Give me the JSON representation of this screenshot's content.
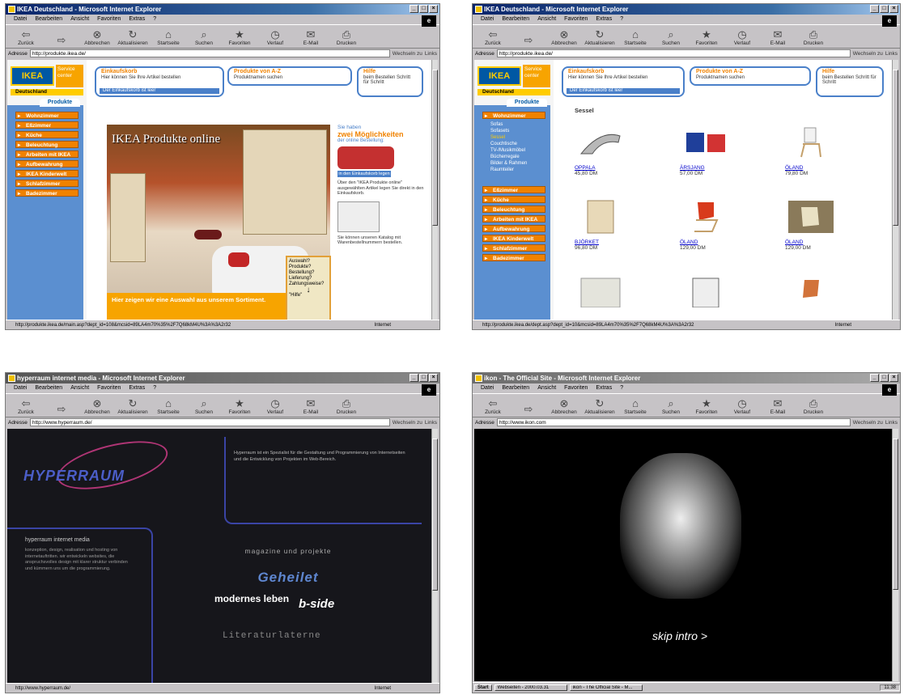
{
  "screenshots": [
    {
      "window_title": "IKEA Deutschland - Microsoft Internet Explorer",
      "address": "http://produkte.ikea.de/",
      "status_url": "http://produkte.ikea.de/main.asp?dept_id=108&mcsid=89LA4m70%35%2F7Q68kM4U%3A%3A2r32",
      "status_zone": "Internet"
    },
    {
      "window_title": "IKEA Deutschland - Microsoft Internet Explorer",
      "address": "http://produkte.ikea.de/",
      "status_url": "http://produkte.ikea.de/dept.asp?dept_id=10&mcsid=89LA4m70%35%2F7Q68kM4U%3A%3A2r32",
      "status_zone": "Internet"
    },
    {
      "window_title": "hyperraum internet media - Microsoft Internet Explorer",
      "address": "http://www.hyperraum.de/",
      "status_url": "http://www.hyperraum.de/",
      "status_zone": "Internet"
    },
    {
      "window_title": "ikon - The Official Site - Microsoft Internet Explorer",
      "address": "http://www.ikon.com",
      "status_url": "",
      "status_zone": ""
    }
  ],
  "browser": {
    "menu": [
      "Datei",
      "Bearbeiten",
      "Ansicht",
      "Favoriten",
      "Extras",
      "?"
    ],
    "toolbar": [
      {
        "label": "Zurück",
        "icon": "back-arrow-icon",
        "glyph": "⇦"
      },
      {
        "label": "",
        "icon": "forward-arrow-icon",
        "glyph": "⇨"
      },
      {
        "label": "Abbrechen",
        "icon": "stop-icon",
        "glyph": "⊗"
      },
      {
        "label": "Aktualisieren",
        "icon": "refresh-icon",
        "glyph": "↻"
      },
      {
        "label": "Startseite",
        "icon": "home-icon",
        "glyph": "⌂"
      },
      {
        "label": "Suchen",
        "icon": "search-icon",
        "glyph": "⌕"
      },
      {
        "label": "Favoriten",
        "icon": "favorites-icon",
        "glyph": "★"
      },
      {
        "label": "Verlauf",
        "icon": "history-icon",
        "glyph": "◷"
      },
      {
        "label": "E-Mail",
        "icon": "mail-icon",
        "glyph": "✉"
      },
      {
        "label": "Drucken",
        "icon": "print-icon",
        "glyph": "⎙"
      }
    ],
    "address_label": "Adresse",
    "go_label": "Wechseln zu",
    "links_label": "Links"
  },
  "ikea": {
    "logo": "IKEA",
    "corner_text": "Service center",
    "country": "Deutschland",
    "nav_tab": "Produkte",
    "nav_items": [
      "Wohnzimmer",
      "Eßzimmer",
      "Küche",
      "Beleuchtung",
      "Arbeiten mit IKEA",
      "Aufbewahrung",
      "IKEA Kinderwelt",
      "Schlafzimmer",
      "Badezimmer"
    ],
    "sub_items": [
      "Sofas",
      "Sofasets",
      "Sessel",
      "Couchtische",
      "TV-/Musikmöbel",
      "Bücherregale",
      "Bilder & Rahmen",
      "Raumteiler"
    ],
    "panel_cart": {
      "title": "Einkaufskorb",
      "text": "Hier können Sie Ihre Artikel bestellen",
      "bar": "Der Einkaufskorb ist leer"
    },
    "panel_az": {
      "title": "Produkte von A-Z",
      "text": "Produktnamen suchen"
    },
    "panel_help": {
      "title": "Hilfe",
      "text": "beim Bestellen Schritt für Schritt"
    },
    "hero_title": "IKEA Produkte online",
    "hero_caption": "Hier zeigen wir eine Auswahl aus unserem Sortiment.",
    "hero_side": "Auswahl? Produkte? Bestellung? Lieferung? Zahlungsweise?",
    "hero_side_help": "\"Hilfe\"",
    "promo_line1": "Sie haben",
    "promo_line2": "zwei Möglichkeiten",
    "promo_line3": "der online Bestellung:",
    "promo_cta": "in den Einkaufskorb legen",
    "promo_text1": "Über den \"IKEA Produkte online\" ausgewählten Artikel legen Sie direkt in den Einkaufskorb.",
    "promo_text2": "Sie können unseren Katalog mit Warenbestellnummern bestellen.",
    "category": "Sessel",
    "products": [
      {
        "name": "OPPALA",
        "price": "45,80 DM"
      },
      {
        "name": "ÄRSJANG",
        "price": "57,00 DM"
      },
      {
        "name": "ÖLAND",
        "price": "79,80 DM"
      },
      {
        "name": "BJÖRKET",
        "price": "96,80 DM"
      },
      {
        "name": "ÖLAND",
        "price": "129,00 DM"
      },
      {
        "name": "ÖLAND",
        "price": "129,00 DM"
      },
      {
        "name": "",
        "price": ""
      },
      {
        "name": "",
        "price": ""
      },
      {
        "name": "",
        "price": ""
      }
    ]
  },
  "hyperraum": {
    "logo": "HYPERRAUM",
    "intro": "Hyperraum ist ein Spezialist für die Gestaltung und Programmierung von Internetseiten und die Entwicklung von Projekten im Web-Bereich.",
    "left_heading": "hyperraum internet media",
    "left_text": "konzeption, design, realisation und hosting von internetauftritten. wir entwickeln websites, die anspruchsvolles design mit klarer struktur verbinden und kümmern uns um die programmierung.",
    "magazine": "magazine und projekte",
    "geheilet": "Geheilet",
    "modernes_leben": "modernes leben",
    "bside": "b-side",
    "literatur": "Literaturlaterne"
  },
  "ikon": {
    "skip": "skip intro >",
    "taskbar_start": "Start",
    "taskbar_tasks": [
      "Webseiten - 2000.03.31",
      "ikon - The Official Site - M..."
    ],
    "clock": "11:38"
  },
  "colors": {
    "ikea_blue": "#0058a3",
    "ikea_yellow": "#ffcc00",
    "ikea_orange": "#f08200",
    "hyperraum_blue": "#3a44a5",
    "hyperraum_pink": "#b03575"
  }
}
